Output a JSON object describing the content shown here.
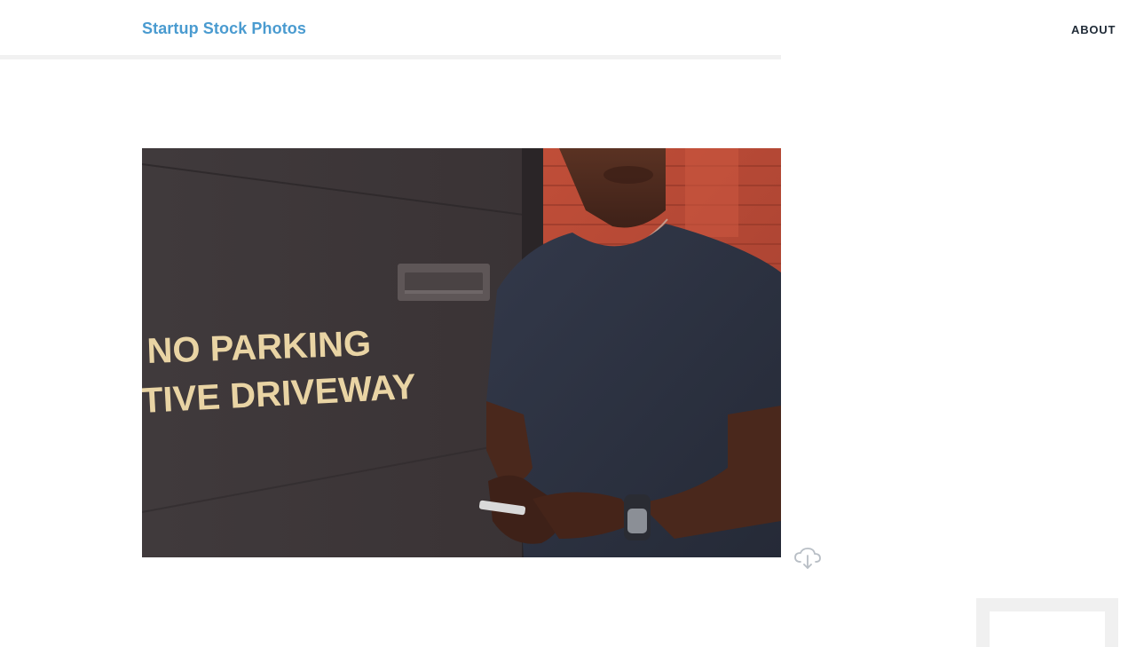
{
  "header": {
    "site_title": "Startup Stock Photos",
    "nav": [
      {
        "label": "ABOUT"
      }
    ]
  },
  "photo": {
    "sign_line_1": "NO PARKING",
    "sign_line_2": "TIVE DRIVEWAY"
  },
  "actions": {
    "download_icon": "cloud-download-icon"
  },
  "colors": {
    "site_title": "#4a9bd0",
    "nav_text": "#1f2a36",
    "header_shadow": "#f1f1f1"
  }
}
